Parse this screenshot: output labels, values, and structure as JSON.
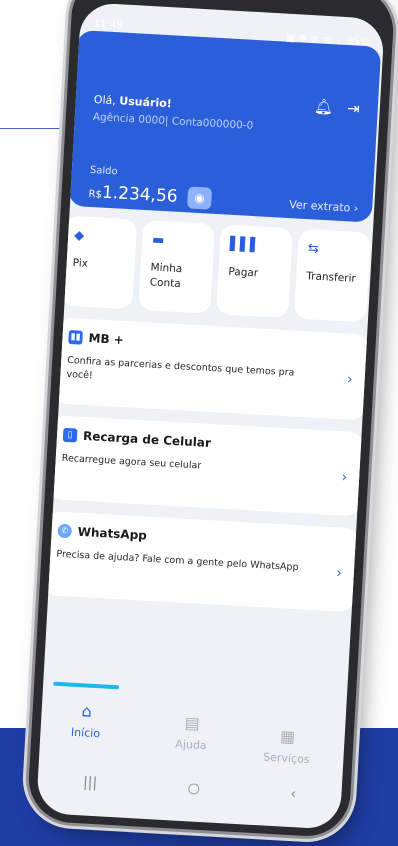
{
  "status": {
    "time": "11:48",
    "right": "▣ ✻ ✉ ᯤ ⋮ 95%"
  },
  "header": {
    "greeting_prefix": "Olá, ",
    "user": "Usuário!",
    "agency_line": "Agência 0000| Conta000000-0",
    "saldo_label": "Saldo",
    "currency": "R$",
    "amount": "1.234,56",
    "extrato": "Ver extrato ›"
  },
  "actions": [
    {
      "icon": "pix-icon",
      "label": "Pix"
    },
    {
      "icon": "wallet-icon",
      "label": "Minha Conta"
    },
    {
      "icon": "barcode-icon",
      "label": "Pagar"
    },
    {
      "icon": "transfer-icon",
      "label": "Transferir"
    }
  ],
  "cards": [
    {
      "title": "MB +",
      "desc": "Confira as parcerias e descontos que temos pra você!"
    },
    {
      "title": "Recarga de Celular",
      "desc": "Recarregue agora seu celular"
    },
    {
      "title": "WhatsApp",
      "desc": "Precisa de ajuda? Fale com a gente pelo WhatsApp"
    }
  ],
  "tabs": [
    {
      "label": "Início"
    },
    {
      "label": "Ajuda"
    },
    {
      "label": "Serviços"
    }
  ],
  "navbar": [
    "|||",
    "○",
    "‹"
  ],
  "colors": {
    "brand": "#2b5fd9",
    "accent": "#20b8e8",
    "bottom_bg": "#1f3ea6"
  }
}
